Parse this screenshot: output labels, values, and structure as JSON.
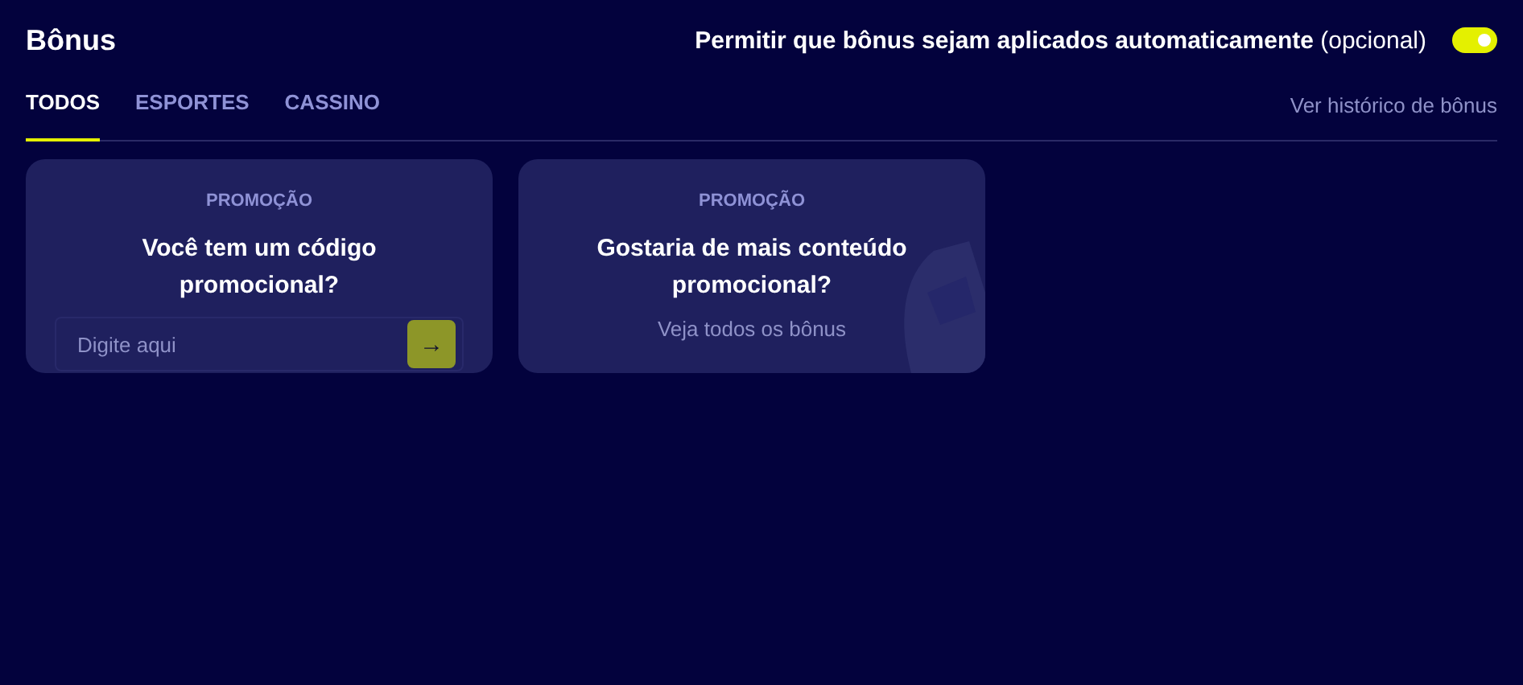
{
  "header": {
    "title": "Bônus",
    "auto_bonus": {
      "label": "**Permitir que bônus sejam aplicados automaticamente** (opcional)",
      "on": true
    }
  },
  "tabs": [
    {
      "label": "TODOS",
      "selected": true
    },
    {
      "label": "ESPORTES",
      "selected": false
    },
    {
      "label": "CASSINO",
      "selected": false
    }
  ],
  "history_link": "Ver histórico de bônus",
  "cards": [
    {
      "kind": "code",
      "tag": "PROMOÇÃO",
      "title": "Você tem um código promocional?",
      "placeholder": "Digite aqui",
      "button": "→"
    },
    {
      "kind": "link",
      "tag": "PROMOÇÃO",
      "title": "Gostaria de mais conteúdo promocional?",
      "link": "Veja todos os bônus"
    }
  ]
}
